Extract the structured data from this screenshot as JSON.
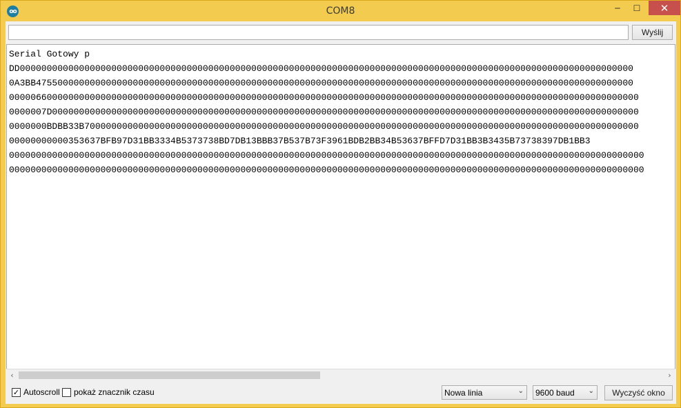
{
  "window": {
    "title": "COM8",
    "app_icon_text": "oo",
    "minimize_glyph": "‒",
    "maximize_glyph": "☐",
    "close_glyph": "✕"
  },
  "send": {
    "input_value": "",
    "input_placeholder": "",
    "button_label": "Wyślij"
  },
  "output": {
    "lines": [
      "Serial Gotowy p",
      "DD000000000000000000000000000000000000000000000000000000000000000000000000000000000000000000000000000000000000000000",
      "0A3BB475500000000000000000000000000000000000000000000000000000000000000000000000000000000000000000000000000000000000",
      "000006600000000000000000000000000000000000000000000000000000000000000000000000000000000000000000000000000000000000000",
      "0000007D0000000000000000000000000000000000000000000000000000000000000000000000000000000000000000000000000000000000000",
      "0000000BDBB33B7000000000000000000000000000000000000000000000000000000000000000000000000000000000000000000000000000000",
      "00000000000353637BFB97D31BB3334B5373738BD7DB13BBB37B537B73F3961BDB2BB34B53637BFFD7D31BB3B3435B73738397DB1BB3",
      "0000000000000000000000000000000000000000000000000000000000000000000000000000000000000000000000000000000000000000000000",
      "0000000000000000000000000000000000000000000000000000000000000000000000000000000000000000000000000000000000000000000000"
    ]
  },
  "scrollbar": {
    "left_arrow": "‹",
    "right_arrow": "›"
  },
  "bottom": {
    "autoscroll_label": "Autoscroll",
    "autoscroll_checked": true,
    "autoscroll_mark": "✓",
    "timestamp_label": "pokaż znacznik czasu",
    "timestamp_checked": false,
    "line_ending_value": "Nowa linia",
    "baud_value": "9600 baud",
    "dropdown_arrow": "⌄",
    "clear_button_label": "Wyczyść okno"
  },
  "colors": {
    "window_frame": "#f2cb4f",
    "close_button": "#c7504d",
    "app_icon": "#1d7ea3"
  }
}
